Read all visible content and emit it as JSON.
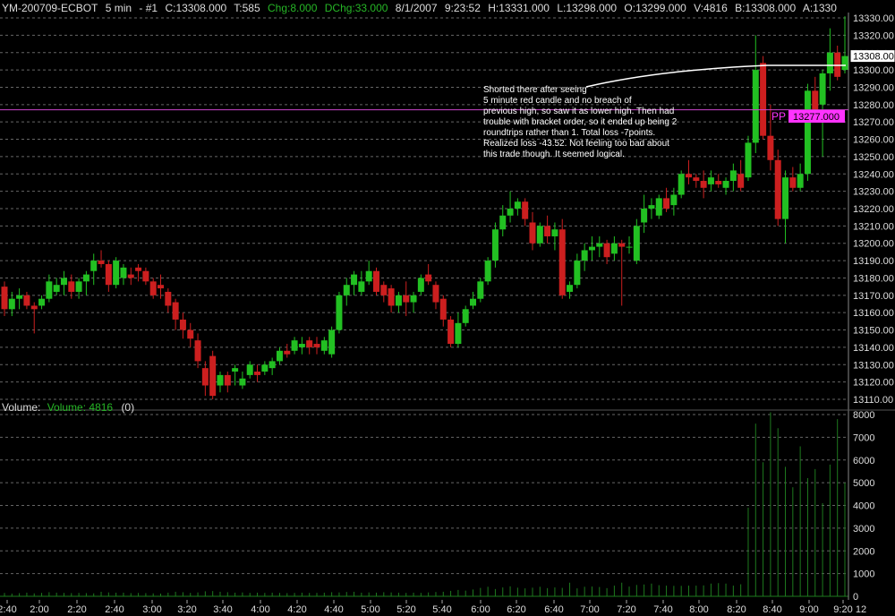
{
  "header": {
    "symbol": "YM-200709-ECBOT",
    "interval": "5 min",
    "chart_no": "- #1",
    "close": "C:13308.000",
    "ticks": "T:585",
    "chg": "Chg:8.000",
    "dchg": "DChg:33.000",
    "date": "8/1/2007",
    "time": "9:23:52",
    "high": "H:13331.000",
    "low": "L:13298.000",
    "open": "O:13299.000",
    "volume": "V:4816",
    "bid": "B:13308.000",
    "ask": "A:1330"
  },
  "annotation": "Shorted there after seeing\n5 minute red candle and no breach of\nprevious high, so saw it as lower high.  Then had\ntrouble with bracket order, so it ended up being 2\nroundtrips rather than 1.  Total loss -7points.\nRealized loss -43.52.  Not feeling too bad about\nthis trade though.  It seemed logical.",
  "volume_panel": {
    "label": "Volume:",
    "series_label": "Volume: 4816",
    "extra": "(0)"
  },
  "colors": {
    "up": "#22c022",
    "down": "#cc1f1f",
    "grid": "#666666",
    "pivot": "#cc44cc",
    "pivot_tag": "#ff33ff",
    "volume": "#1e7a1e",
    "header_green": "#26b626"
  },
  "chart_data": [
    {
      "type": "candlestick",
      "title": "",
      "ylim": [
        13105,
        13335
      ],
      "y_ticks": [
        "13330.00",
        "13320.00",
        "13310.00",
        "13300.00",
        "13290.00",
        "13280.00",
        "13270.00",
        "13260.00",
        "13250.00",
        "13240.00",
        "13230.00",
        "13220.00",
        "13210.00",
        "13200.00",
        "13190.00",
        "13180.00",
        "13170.00",
        "13160.00",
        "13150.00",
        "13140.00",
        "13130.00",
        "13120.00",
        "13110.00"
      ],
      "last_price_tag": "13308.00",
      "pivot_label": "PP",
      "pivot_value": 13277,
      "pivot_tag": "13277.000",
      "candles": [
        [
          13175,
          13178,
          13158,
          13162
        ],
        [
          13162,
          13172,
          13158,
          13168
        ],
        [
          13168,
          13174,
          13162,
          13170
        ],
        [
          13170,
          13172,
          13162,
          13164
        ],
        [
          13164,
          13166,
          13148,
          13162
        ],
        [
          13164,
          13170,
          13162,
          13168
        ],
        [
          13168,
          13182,
          13166,
          13178
        ],
        [
          13172,
          13180,
          13170,
          13176
        ],
        [
          13176,
          13184,
          13170,
          13180
        ],
        [
          13178,
          13182,
          13168,
          13172
        ],
        [
          13172,
          13180,
          13168,
          13178
        ],
        [
          13178,
          13184,
          13170,
          13182
        ],
        [
          13184,
          13194,
          13176,
          13190
        ],
        [
          13190,
          13196,
          13186,
          13188
        ],
        [
          13188,
          13190,
          13172,
          13176
        ],
        [
          13176,
          13192,
          13174,
          13190
        ],
        [
          13180,
          13188,
          13176,
          13186
        ],
        [
          13182,
          13186,
          13176,
          13180
        ],
        [
          13186,
          13188,
          13178,
          13184
        ],
        [
          13184,
          13186,
          13176,
          13178
        ],
        [
          13178,
          13180,
          13168,
          13170
        ],
        [
          13176,
          13182,
          13168,
          13174
        ],
        [
          13172,
          13174,
          13160,
          13164
        ],
        [
          13166,
          13168,
          13150,
          13156
        ],
        [
          13156,
          13160,
          13145,
          13150
        ],
        [
          13150,
          13154,
          13140,
          13145
        ],
        [
          13144,
          13148,
          13128,
          13132
        ],
        [
          13128,
          13132,
          13112,
          13118
        ],
        [
          13135,
          13138,
          13110,
          13112
        ],
        [
          13118,
          13126,
          13114,
          13124
        ],
        [
          13124,
          13126,
          13114,
          13118
        ],
        [
          13126,
          13130,
          13118,
          13128
        ],
        [
          13118,
          13126,
          13116,
          13122
        ],
        [
          13124,
          13132,
          13122,
          13130
        ],
        [
          13126,
          13130,
          13120,
          13124
        ],
        [
          13126,
          13132,
          13124,
          13130
        ],
        [
          13128,
          13134,
          13124,
          13132
        ],
        [
          13132,
          13140,
          13130,
          13138
        ],
        [
          13138,
          13142,
          13134,
          13136
        ],
        [
          13138,
          13146,
          13136,
          13144
        ],
        [
          13140,
          13146,
          13136,
          13142
        ],
        [
          13144,
          13146,
          13136,
          13140
        ],
        [
          13142,
          13146,
          13136,
          13140
        ],
        [
          13138,
          13146,
          13136,
          13144
        ],
        [
          13136,
          13152,
          13134,
          13150
        ],
        [
          13150,
          13172,
          13148,
          13170
        ],
        [
          13170,
          13180,
          13164,
          13176
        ],
        [
          13176,
          13184,
          13170,
          13182
        ],
        [
          13172,
          13184,
          13170,
          13178
        ],
        [
          13178,
          13190,
          13176,
          13184
        ],
        [
          13184,
          13186,
          13170,
          13172
        ],
        [
          13176,
          13178,
          13166,
          13170
        ],
        [
          13174,
          13176,
          13160,
          13164
        ],
        [
          13164,
          13172,
          13160,
          13170
        ],
        [
          13170,
          13178,
          13158,
          13166
        ],
        [
          13166,
          13172,
          13160,
          13170
        ],
        [
          13172,
          13182,
          13170,
          13180
        ],
        [
          13182,
          13188,
          13176,
          13178
        ],
        [
          13176,
          13178,
          13162,
          13166
        ],
        [
          13168,
          13170,
          13152,
          13156
        ],
        [
          13156,
          13158,
          13140,
          13142
        ],
        [
          13142,
          13160,
          13140,
          13154
        ],
        [
          13154,
          13164,
          13152,
          13162
        ],
        [
          13164,
          13172,
          13162,
          13168
        ],
        [
          13168,
          13180,
          13166,
          13178
        ],
        [
          13178,
          13192,
          13176,
          13190
        ],
        [
          13190,
          13212,
          13186,
          13208
        ],
        [
          13208,
          13222,
          13204,
          13216
        ],
        [
          13216,
          13230,
          13212,
          13220
        ],
        [
          13220,
          13226,
          13216,
          13224
        ],
        [
          13224,
          13226,
          13210,
          13214
        ],
        [
          13212,
          13218,
          13196,
          13200
        ],
        [
          13200,
          13212,
          13198,
          13210
        ],
        [
          13210,
          13216,
          13200,
          13204
        ],
        [
          13204,
          13212,
          13196,
          13208
        ],
        [
          13208,
          13214,
          13168,
          13170
        ],
        [
          13172,
          13178,
          13168,
          13176
        ],
        [
          13176,
          13194,
          13174,
          13190
        ],
        [
          13190,
          13200,
          13184,
          13196
        ],
        [
          13196,
          13204,
          13190,
          13198
        ],
        [
          13198,
          13204,
          13192,
          13200
        ],
        [
          13200,
          13202,
          13188,
          13192
        ],
        [
          13194,
          13204,
          13190,
          13200
        ],
        [
          13200,
          13202,
          13164,
          13198
        ],
        [
          13198,
          13204,
          13194,
          13198
        ],
        [
          13190,
          13214,
          13188,
          13210
        ],
        [
          13212,
          13228,
          13206,
          13220
        ],
        [
          13220,
          13226,
          13214,
          13222
        ],
        [
          13216,
          13228,
          13214,
          13226
        ],
        [
          13226,
          13232,
          13218,
          13220
        ],
        [
          13222,
          13232,
          13216,
          13228
        ],
        [
          13228,
          13242,
          13226,
          13240
        ],
        [
          13240,
          13248,
          13234,
          13238
        ],
        [
          13238,
          13240,
          13232,
          13236
        ],
        [
          13236,
          13242,
          13226,
          13232
        ],
        [
          13234,
          13242,
          13230,
          13238
        ],
        [
          13236,
          13240,
          13232,
          13234
        ],
        [
          13232,
          13238,
          13228,
          13236
        ],
        [
          13236,
          13246,
          13230,
          13242
        ],
        [
          13240,
          13248,
          13230,
          13232
        ],
        [
          13238,
          13262,
          13236,
          13258
        ],
        [
          13258,
          13320,
          13252,
          13300
        ],
        [
          13304,
          13308,
          13260,
          13262
        ],
        [
          13262,
          13280,
          13242,
          13248
        ],
        [
          13248,
          13254,
          13210,
          13214
        ],
        [
          13214,
          13242,
          13200,
          13238
        ],
        [
          13238,
          13244,
          13230,
          13232
        ],
        [
          13232,
          13246,
          13230,
          13240
        ],
        [
          13240,
          13292,
          13236,
          13288
        ],
        [
          13288,
          13296,
          13270,
          13276
        ],
        [
          13280,
          13300,
          13250,
          13298
        ],
        [
          13298,
          13324,
          13288,
          13310
        ],
        [
          13310,
          13314,
          13294,
          13296
        ],
        [
          13300,
          13331,
          13298,
          13308
        ]
      ],
      "x_ticks": [
        "2:40",
        "2:00",
        "2:20",
        "2:40",
        "3:00",
        "3:20",
        "3:40",
        "4:00",
        "4:20",
        "4:40",
        "5:00",
        "5:20",
        "5:40",
        "6:00",
        "6:20",
        "6:40",
        "7:00",
        "7:20",
        "7:40",
        "8:00",
        "8:20",
        "8:40",
        "9:00",
        "9:20"
      ],
      "x_tick_pos": [
        8,
        44,
        86,
        128,
        170,
        209,
        249,
        291,
        332,
        373,
        414,
        454,
        494,
        537,
        577,
        619,
        659,
        700,
        741,
        781,
        823,
        863,
        904,
        942
      ],
      "x_axis_extra": "12"
    },
    {
      "type": "bar",
      "title": "Volume",
      "ylim": [
        0,
        8200
      ],
      "y_ticks": [
        "8000",
        "7000",
        "6000",
        "5000",
        "4000",
        "3000",
        "2000",
        "1000",
        "0"
      ],
      "values": [
        150,
        120,
        140,
        160,
        130,
        150,
        180,
        160,
        150,
        140,
        150,
        140,
        130,
        200,
        170,
        160,
        160,
        140,
        150,
        140,
        130,
        120,
        160,
        200,
        180,
        150,
        170,
        220,
        230,
        200,
        180,
        160,
        170,
        150,
        160,
        150,
        160,
        150,
        140,
        150,
        160,
        150,
        150,
        160,
        180,
        170,
        190,
        200,
        160,
        170,
        160,
        180,
        170,
        160,
        150,
        160,
        150,
        170,
        190,
        200,
        240,
        280,
        250,
        300,
        370,
        420,
        320,
        390,
        440,
        380,
        350,
        380,
        420,
        360,
        390,
        370,
        600,
        350,
        420,
        430,
        410,
        360,
        470,
        600,
        430,
        500,
        520,
        560,
        490,
        470,
        460,
        460,
        470,
        470,
        480,
        560,
        580,
        560,
        470,
        530,
        3900,
        7600,
        5900,
        8100,
        7400,
        5700,
        4800,
        6600,
        5200,
        5600,
        4100,
        5800,
        7800,
        5000
      ]
    }
  ]
}
